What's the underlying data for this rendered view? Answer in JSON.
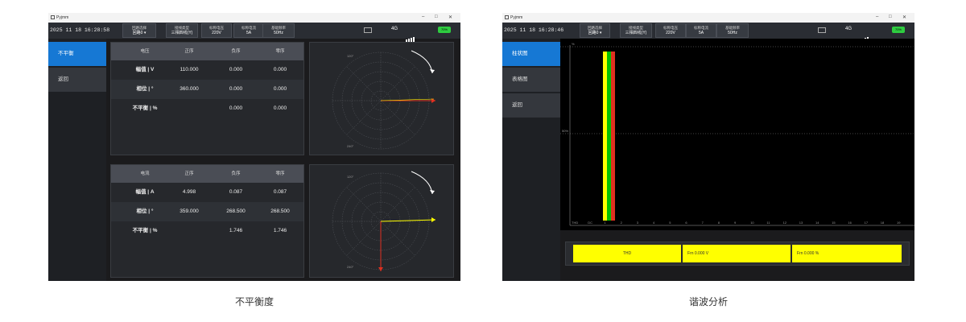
{
  "left_screen": {
    "app_title": "Pyjmm",
    "datetime": "2025 11 18 16:28:58",
    "header_cells": [
      {
        "label": "回路选择",
        "value": "回路0 ▾"
      },
      {
        "label": "接线类型",
        "value": "三相四线(Y)"
      },
      {
        "label": "标称电压",
        "value": "220V"
      },
      {
        "label": "标称电流",
        "value": "5A"
      },
      {
        "label": "基础频率",
        "value": "50Hz"
      }
    ],
    "network": "4G",
    "battery": "70%",
    "sidebar": [
      {
        "label": "不平衡",
        "active": true
      },
      {
        "label": "返回",
        "active": false
      }
    ],
    "voltage_table": {
      "headers": [
        "电压",
        "正序",
        "负序",
        "零序"
      ],
      "rows": [
        [
          "幅值 | V",
          "110.000",
          "0.000",
          "0.000"
        ],
        [
          "相位 | °",
          "360.000",
          "0.000",
          "0.000"
        ],
        [
          "不平衡 | %",
          "",
          "0.000",
          "0.000"
        ]
      ]
    },
    "current_table": {
      "headers": [
        "电流",
        "正序",
        "负序",
        "零序"
      ],
      "rows": [
        [
          "幅值 | A",
          "4.998",
          "0.087",
          "0.087"
        ],
        [
          "相位 | °",
          "359.000",
          "268.500",
          "268.500"
        ],
        [
          "不平衡 | %",
          "",
          "1.746",
          "1.746"
        ]
      ]
    },
    "polar_labels": [
      "120°",
      "240°"
    ],
    "colors": {
      "phase_a": "#ffff00",
      "phase_b": "#00c000",
      "phase_c": "#e03020",
      "accent": "#1678d4"
    }
  },
  "right_screen": {
    "app_title": "Pyjmm",
    "datetime": "2025 11 18 16:28:46",
    "header_cells": [
      {
        "label": "回路选择",
        "value": "回路0 ▾"
      },
      {
        "label": "接线类型",
        "value": "三相四线(Y)"
      },
      {
        "label": "标称电压",
        "value": "220V"
      },
      {
        "label": "标称电流",
        "value": "5A"
      },
      {
        "label": "基础频率",
        "value": "50Hz"
      }
    ],
    "network": "4G",
    "battery": "70%",
    "sidebar": [
      {
        "label": "柱状图",
        "active": true
      },
      {
        "label": "表格图",
        "active": false
      },
      {
        "label": "返回",
        "active": false
      }
    ],
    "y_labels": [
      "%",
      "50%"
    ],
    "x_labels": [
      "THD",
      "DC",
      "1",
      "2",
      "3",
      "4",
      "5",
      "6",
      "7",
      "8",
      "9",
      "10",
      "11",
      "12",
      "13",
      "14",
      "15",
      "16",
      "17",
      "18",
      "19"
    ],
    "harmonic_bars": {
      "series": [
        {
          "color": "#ffff00",
          "value": 100
        },
        {
          "color": "#00c000",
          "value": 100
        },
        {
          "color": "#e03020",
          "value": 100
        }
      ]
    },
    "readouts": [
      "THD",
      "Frn 0.000 V",
      "Frn 0.000 %"
    ]
  },
  "captions": {
    "left": "不平衡度",
    "right": "谐波分析"
  }
}
